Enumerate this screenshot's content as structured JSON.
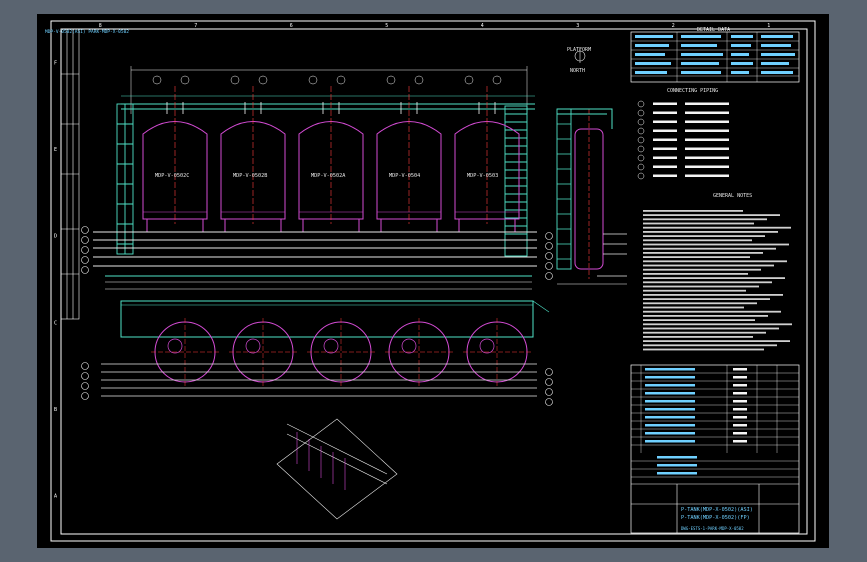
{
  "colors": {
    "frame": "#ffffff",
    "tank": "#d34bd3",
    "pipe": "#e8e8e8",
    "structure": "#4fe3c8",
    "dim": "#f4f4f4",
    "text": "#e6e6e6",
    "centerline": "#ff3b3b",
    "title": "#6fd0ff"
  },
  "border": {
    "top_zones": [
      "8",
      "7",
      "6",
      "5",
      "4",
      "3",
      "2",
      "1"
    ],
    "side_zones": [
      "F",
      "E",
      "D",
      "C",
      "B",
      "A"
    ]
  },
  "tanks": [
    {
      "tag": "MDP-V-0502C"
    },
    {
      "tag": "MDP-V-0502B"
    },
    {
      "tag": "MDP-V-0502A"
    },
    {
      "tag": "MDP-V-0504"
    },
    {
      "tag": "MDP-V-0503"
    }
  ],
  "plan_label": "PLATFORM",
  "north_label": "NORTH",
  "sections": {
    "detail_data": "DETAIL DATA",
    "connecting_piping": "CONNECTING PIPING",
    "general_notes": "GENERAL NOTES"
  },
  "title_block": {
    "line1": "P-TANK(MDP-X-0502)(ASI)",
    "line2": "P-TANK(MDP-X-0502)(FP)",
    "drawing_no": "DWG-ESTS-1-PARK-MDP-X-0502"
  }
}
